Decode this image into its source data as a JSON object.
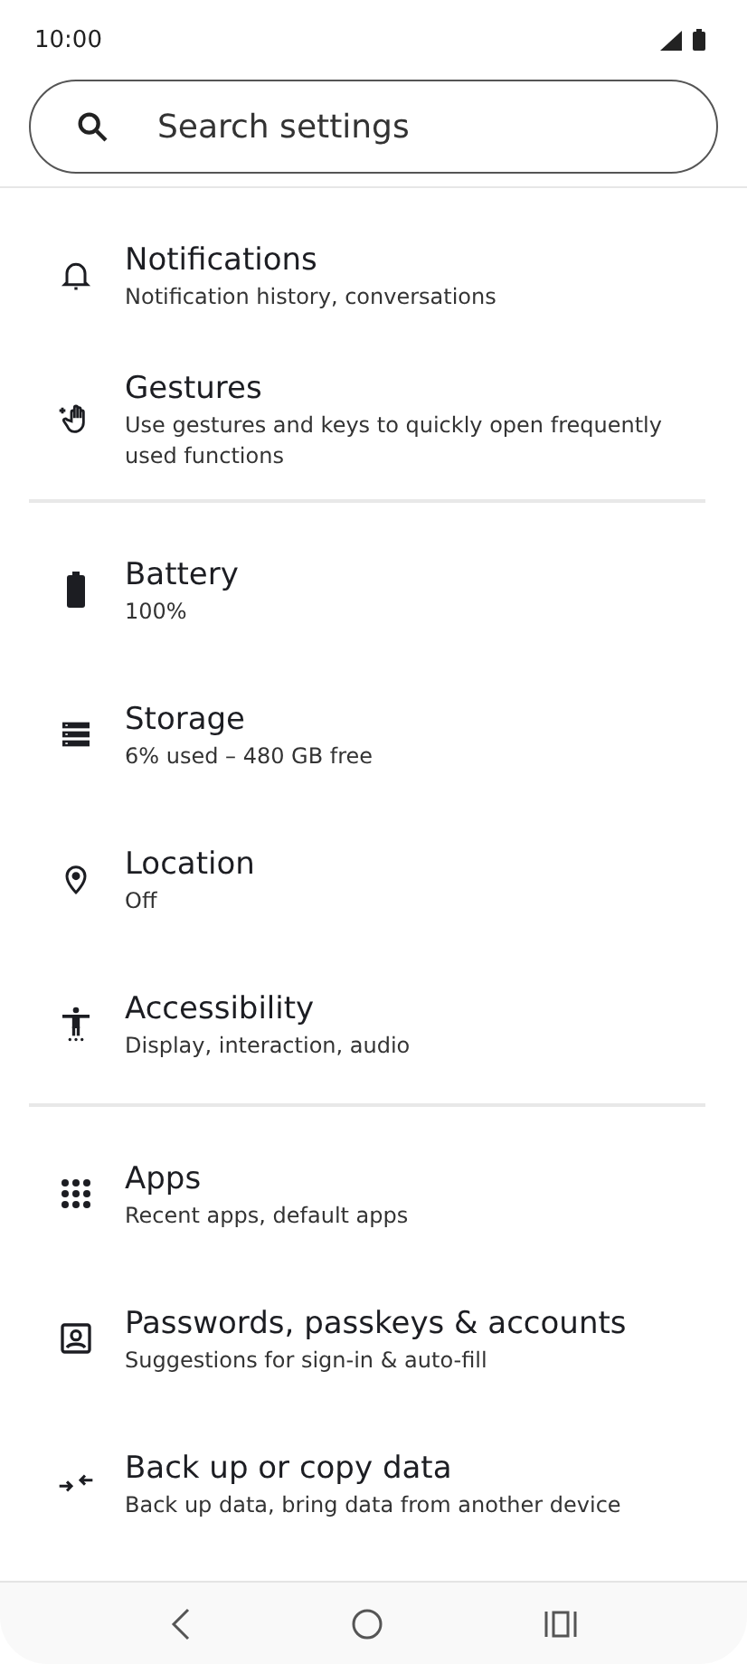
{
  "status_bar": {
    "time": "10:00"
  },
  "search": {
    "placeholder": "Search settings"
  },
  "sections": [
    {
      "items": [
        {
          "title": "Notifications",
          "subtitle": "Notification history, conversations"
        },
        {
          "title": "Gestures",
          "subtitle": "Use gestures and keys to quickly open frequently used functions"
        }
      ]
    },
    {
      "items": [
        {
          "title": "Battery",
          "subtitle": "100%"
        },
        {
          "title": "Storage",
          "subtitle": "6% used – 480 GB free"
        },
        {
          "title": "Location",
          "subtitle": "Off"
        },
        {
          "title": "Accessibility",
          "subtitle": "Display, interaction, audio"
        }
      ]
    },
    {
      "items": [
        {
          "title": "Apps",
          "subtitle": "Recent apps, default apps"
        },
        {
          "title": "Passwords, passkeys & accounts",
          "subtitle": "Suggestions for sign-in & auto-fill"
        },
        {
          "title": "Back up or copy data",
          "subtitle": "Back up data, bring data from another device"
        }
      ]
    }
  ]
}
